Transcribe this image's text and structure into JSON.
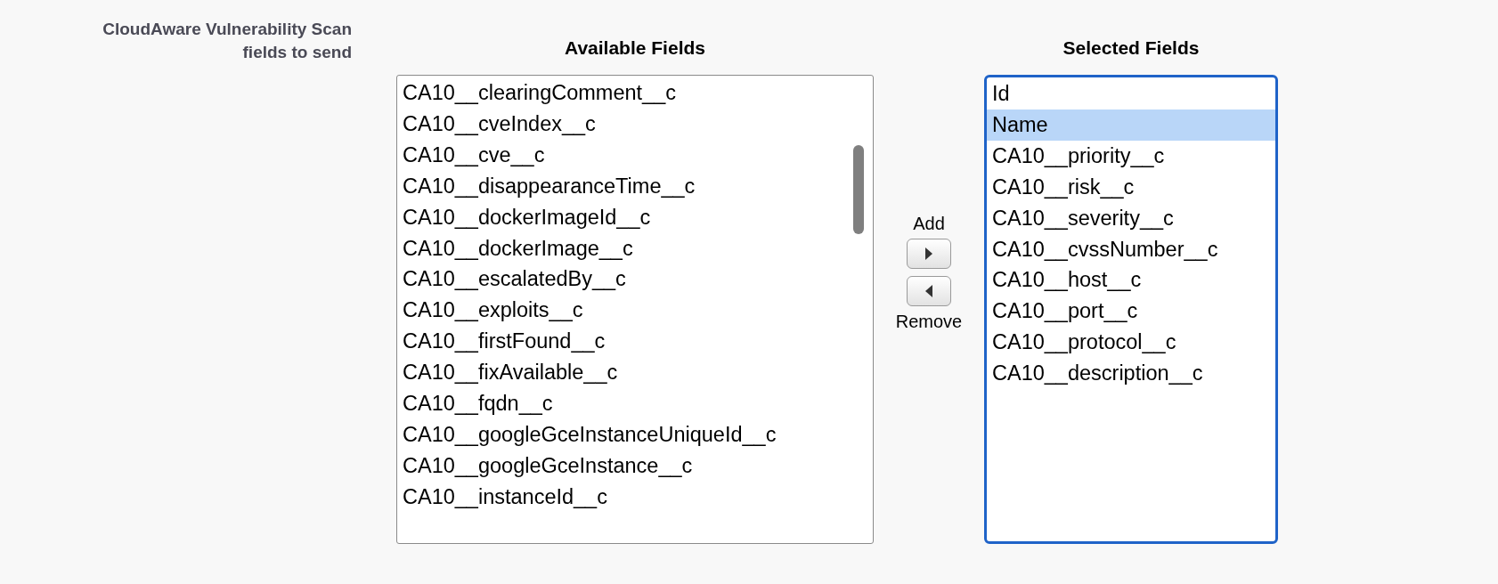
{
  "field_label": {
    "line_1": "CloudAware Vulnerability Scan",
    "line_2": "fields to send"
  },
  "available_fields": {
    "heading": "Available Fields",
    "items": [
      {
        "label": "CA10__clearingComment__c",
        "selected": false
      },
      {
        "label": "CA10__cveIndex__c",
        "selected": false
      },
      {
        "label": "CA10__cve__c",
        "selected": false
      },
      {
        "label": "CA10__disappearanceTime__c",
        "selected": false
      },
      {
        "label": "CA10__dockerImageId__c",
        "selected": false
      },
      {
        "label": "CA10__dockerImage__c",
        "selected": false
      },
      {
        "label": "CA10__escalatedBy__c",
        "selected": false
      },
      {
        "label": "CA10__exploits__c",
        "selected": false
      },
      {
        "label": "CA10__firstFound__c",
        "selected": false
      },
      {
        "label": "CA10__fixAvailable__c",
        "selected": false
      },
      {
        "label": "CA10__fqdn__c",
        "selected": false
      },
      {
        "label": "CA10__googleGceInstanceUniqueId__c",
        "selected": false
      },
      {
        "label": "CA10__googleGceInstance__c",
        "selected": false
      },
      {
        "label": "CA10__instanceId__c",
        "selected": false
      }
    ]
  },
  "add_label": "Add",
  "remove_label": "Remove",
  "selected_fields": {
    "heading": "Selected Fields",
    "focused": true,
    "items": [
      {
        "label": "Id",
        "selected": false
      },
      {
        "label": "Name",
        "selected": true
      },
      {
        "label": "CA10__priority__c",
        "selected": false
      },
      {
        "label": "CA10__risk__c",
        "selected": false
      },
      {
        "label": "CA10__severity__c",
        "selected": false
      },
      {
        "label": "CA10__cvssNumber__c",
        "selected": false
      },
      {
        "label": "CA10__host__c",
        "selected": false
      },
      {
        "label": "CA10__port__c",
        "selected": false
      },
      {
        "label": "CA10__protocol__c",
        "selected": false
      },
      {
        "label": "CA10__description__c",
        "selected": false
      }
    ]
  }
}
